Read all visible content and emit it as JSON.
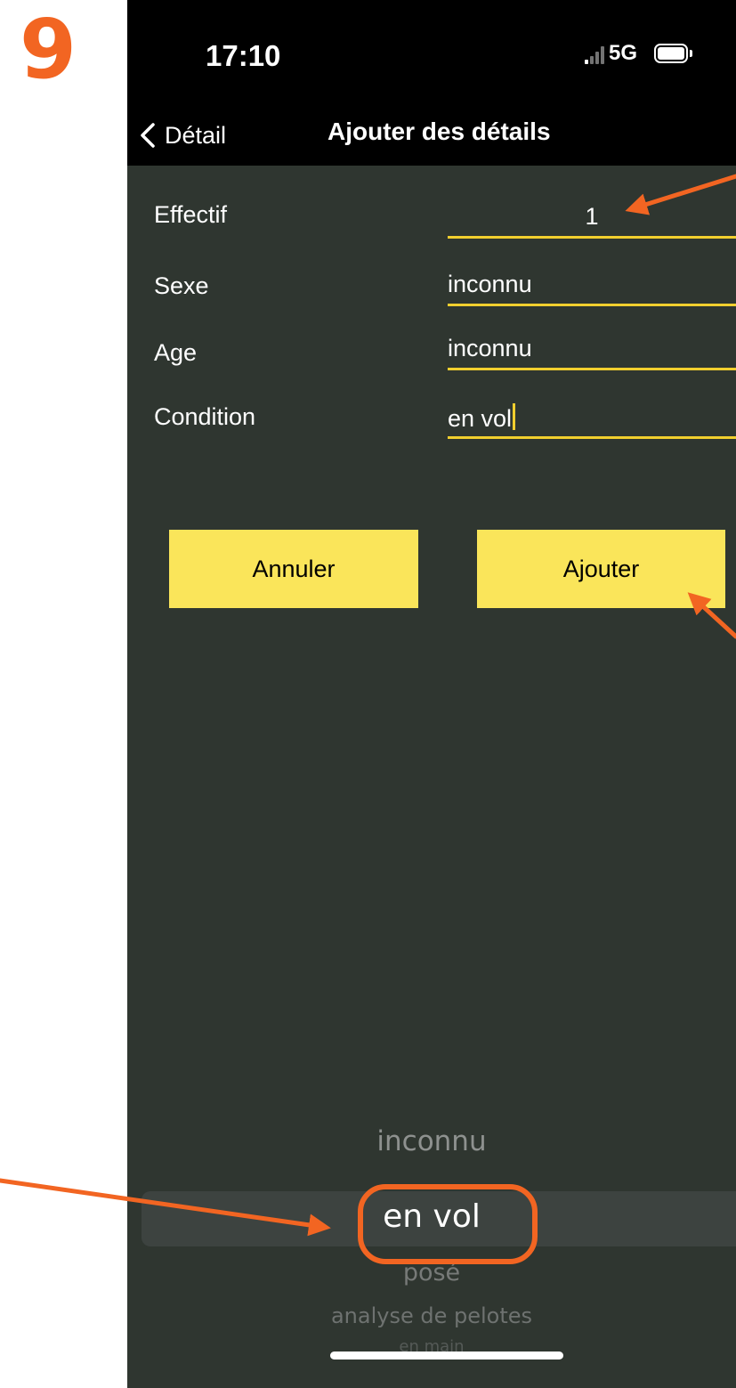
{
  "step_number": "9",
  "status_bar": {
    "time": "17:10",
    "network": "5G"
  },
  "nav": {
    "back_label": "Détail",
    "title": "Ajouter des détails"
  },
  "form": {
    "fields": [
      {
        "label": "Effectif",
        "value": "1"
      },
      {
        "label": "Sexe",
        "value": "inconnu"
      },
      {
        "label": "Age",
        "value": "inconnu"
      },
      {
        "label": "Condition",
        "value": "en vol"
      }
    ]
  },
  "buttons": {
    "cancel": "Annuler",
    "add": "Ajouter"
  },
  "picker": {
    "items": [
      "inconnu",
      "en vol",
      "posé",
      "analyse de pelotes",
      "en main"
    ],
    "selected": "en vol"
  },
  "annotation_color": "#f26522",
  "accent_color": "#f1cf2e",
  "button_color": "#fae55a"
}
